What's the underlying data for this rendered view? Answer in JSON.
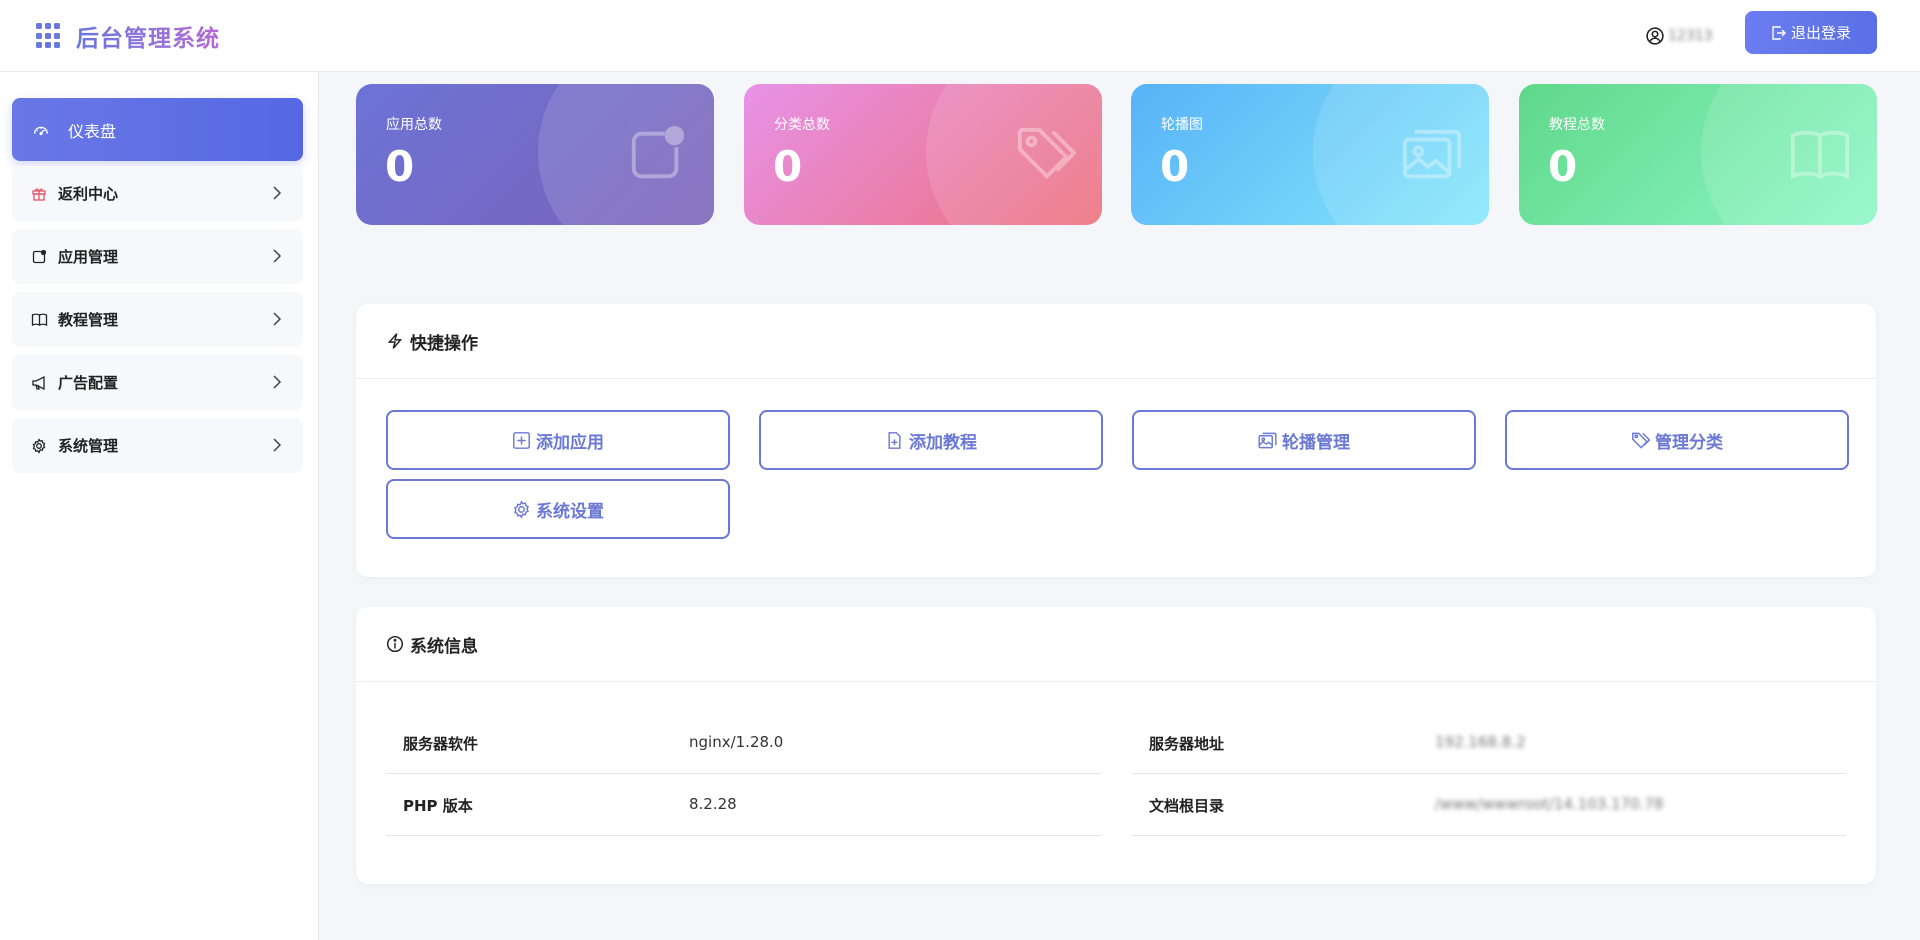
{
  "header": {
    "title": "后台管理系统",
    "username": "12313",
    "logout_label": "退出登录"
  },
  "sidebar": {
    "items": [
      {
        "label": "仪表盘",
        "icon": "dashboard-icon",
        "active": true
      },
      {
        "label": "返利中心",
        "icon": "gift-icon"
      },
      {
        "label": "应用管理",
        "icon": "app-icon"
      },
      {
        "label": "教程管理",
        "icon": "book-icon"
      },
      {
        "label": "广告配置",
        "icon": "megaphone-icon"
      },
      {
        "label": "系统管理",
        "icon": "gear-icon"
      }
    ]
  },
  "stats": [
    {
      "label": "应用总数",
      "value": "0",
      "icon": "app-icon"
    },
    {
      "label": "分类总数",
      "value": "0",
      "icon": "tag-icon"
    },
    {
      "label": "轮播图",
      "value": "0",
      "icon": "images-icon"
    },
    {
      "label": "教程总数",
      "value": "0",
      "icon": "book-icon"
    }
  ],
  "quick": {
    "title": "快捷操作",
    "buttons": [
      {
        "label": "添加应用",
        "icon": "plus-square-icon"
      },
      {
        "label": "添加教程",
        "icon": "file-plus-icon"
      },
      {
        "label": "轮播管理",
        "icon": "images-icon"
      },
      {
        "label": "管理分类",
        "icon": "tag-icon"
      },
      {
        "label": "系统设置",
        "icon": "gear-icon"
      }
    ]
  },
  "sysinfo": {
    "title": "系统信息",
    "rows": [
      {
        "label": "服务器软件",
        "value": "nginx/1.28.0"
      },
      {
        "label": "PHP 版本",
        "value": "8.2.28"
      },
      {
        "label": "服务器地址",
        "value": "192.168.8.2"
      },
      {
        "label": "文档根目录",
        "value": "/www/wwwroot/14.103.170.78"
      }
    ]
  },
  "colors": {
    "accent": "#5a6fe6",
    "card1": "#6c73d6",
    "card2": "#ec6f7a",
    "card3": "#58b2f7",
    "card4": "#5fd88a"
  }
}
